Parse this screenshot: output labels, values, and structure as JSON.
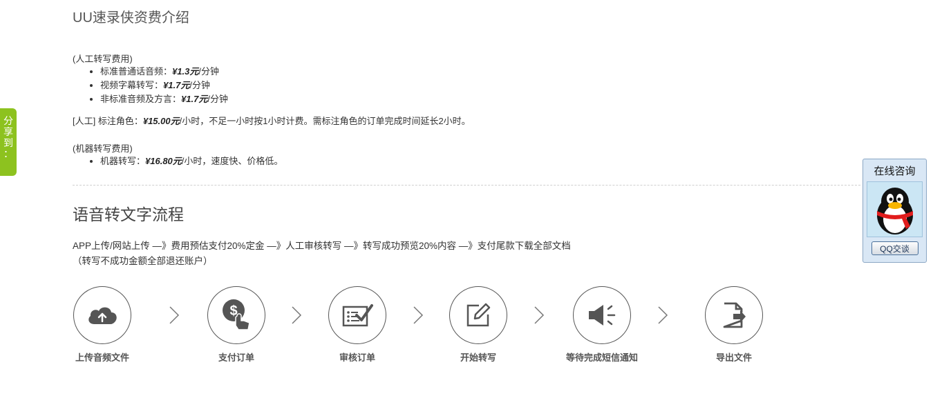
{
  "page_title": "UU速录侠资费介绍",
  "manual_section": {
    "label": "(人工转写费用)",
    "items": [
      {
        "name": "标准普通话音频：",
        "price": "¥1.3元",
        "unit": "/分钟"
      },
      {
        "name": "视频字幕转写：",
        "price": "¥1.7元",
        "unit": "/分钟"
      },
      {
        "name": "非标准音频及方言：",
        "price": "¥1.7元",
        "unit": "/分钟"
      }
    ]
  },
  "role_line": {
    "prefix": "[人工] 标注角色：",
    "price": "¥15.00元",
    "suffix": "/小时，不足一小时按1小时计费。需标注角色的订单完成时间延长2小时。"
  },
  "machine_section": {
    "label": "(机器转写费用)",
    "items": [
      {
        "name": "机器转写：",
        "price": "¥16.80元",
        "unit": "/小时，速度快、价格低。"
      }
    ]
  },
  "flow": {
    "title": "语音转文字流程",
    "description_line1": "APP上传/网站上传 —》费用预估支付20%定金 —》人工审核转写 —》转写成功预览20%内容 —》支付尾款下载全部文档",
    "description_line2": "（转写不成功金额全部退还账户）",
    "steps": [
      {
        "label": "上传音频文件",
        "icon": "cloud-upload-icon"
      },
      {
        "label": "支付订单",
        "icon": "payment-icon"
      },
      {
        "label": "审核订单",
        "icon": "review-checklist-icon"
      },
      {
        "label": "开始转写",
        "icon": "edit-pencil-icon"
      },
      {
        "label": "等待完成短信通知",
        "icon": "speaker-notify-icon"
      },
      {
        "label": "导出文件",
        "icon": "export-file-icon"
      }
    ]
  },
  "share_tab": {
    "chars": [
      "分",
      "享",
      "到",
      "："
    ]
  },
  "consult": {
    "title": "在线咨询",
    "button_label": "QQ交谈"
  },
  "colors": {
    "share_green": "#8dc21f",
    "consult_bg": "#d9e7f5",
    "icon_gray": "#555555"
  }
}
